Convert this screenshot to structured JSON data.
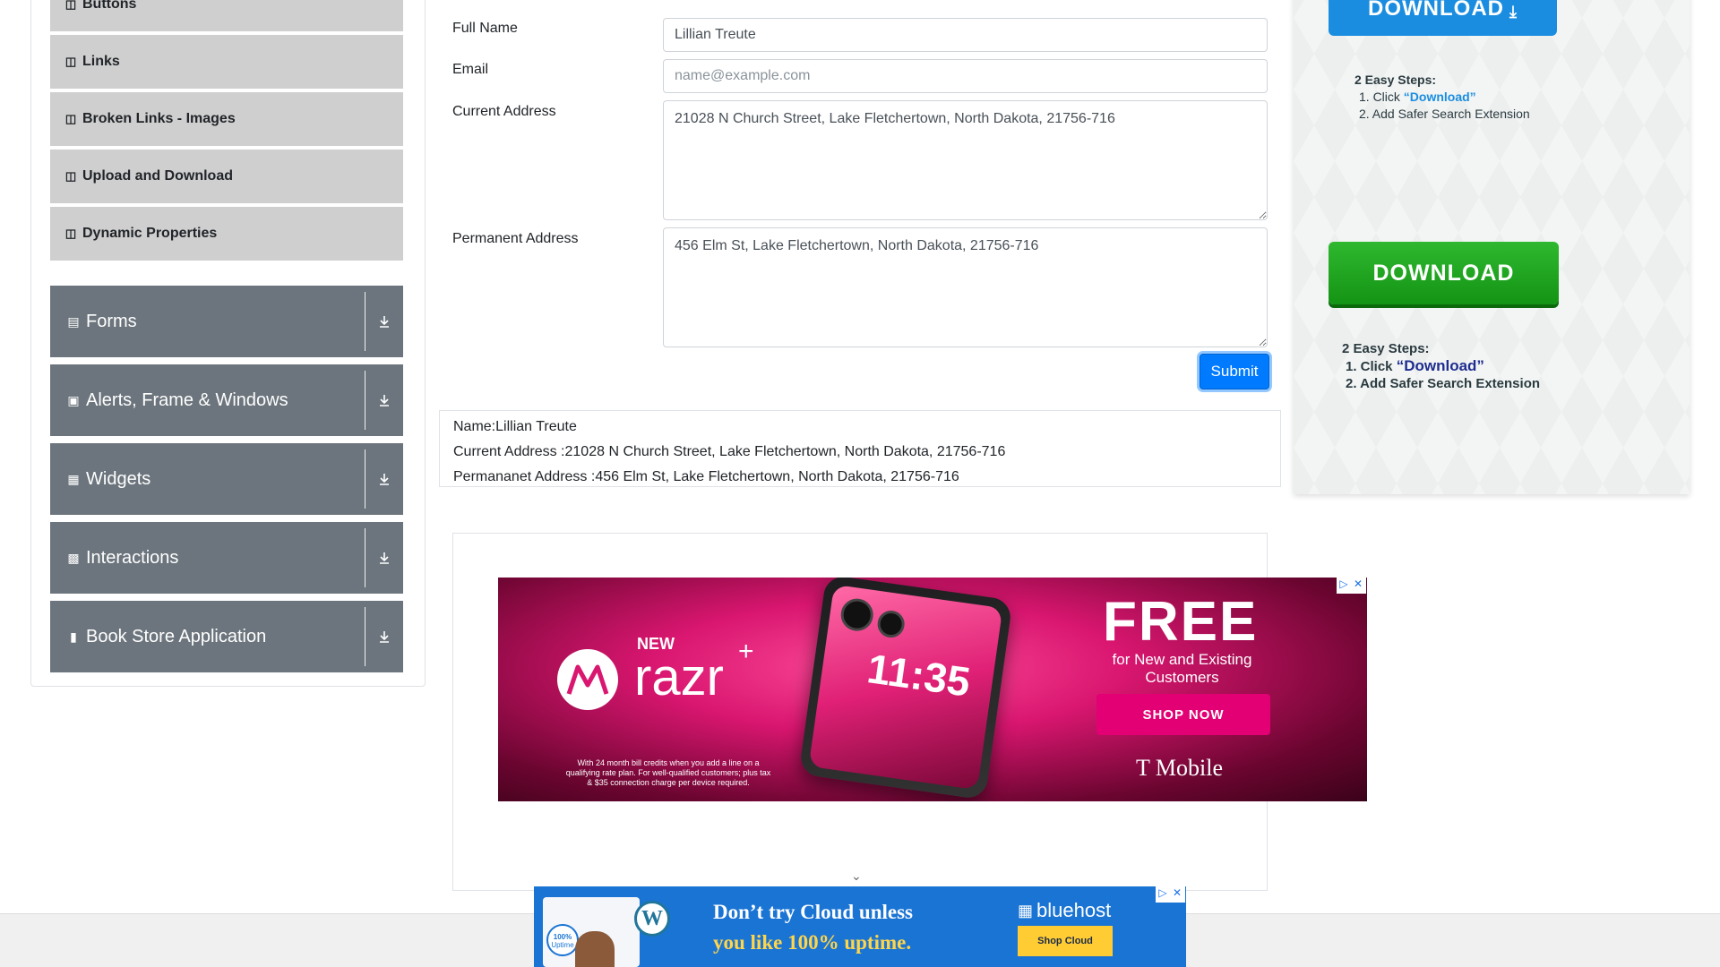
{
  "sidebar": {
    "sub_items": [
      {
        "label": "Buttons"
      },
      {
        "label": "Links"
      },
      {
        "label": "Broken Links - Images"
      },
      {
        "label": "Upload and Download"
      },
      {
        "label": "Dynamic Properties"
      }
    ],
    "groups": [
      {
        "label": "Forms",
        "icon": "form-icon"
      },
      {
        "label": "Alerts, Frame & Windows",
        "icon": "window-icon"
      },
      {
        "label": "Widgets",
        "icon": "widgets-icon"
      },
      {
        "label": "Interactions",
        "icon": "interactions-icon"
      },
      {
        "label": "Book Store Application",
        "icon": "books-icon"
      }
    ]
  },
  "form": {
    "full_name": {
      "label": "Full Name",
      "value": "Lillian Treute"
    },
    "email": {
      "label": "Email",
      "placeholder": "name@example.com",
      "value": ""
    },
    "current_address": {
      "label": "Current Address",
      "value": "21028 N Church Street, Lake Fletchertown, North Dakota, 21756-716"
    },
    "permanent_address": {
      "label": "Permanent Address",
      "value": "456 Elm St, Lake Fletchertown, North Dakota, 21756-716"
    },
    "submit_label": "Submit"
  },
  "output": {
    "name": "Name:Lillian Treute",
    "current_address": "Current Address :21028 N Church Street, Lake Fletchertown, North Dakota, 21756-716",
    "permanent_address": "Permananet Address :456 Elm St, Lake Fletchertown, North Dakota, 21756-716"
  },
  "right_ad": {
    "download_top": "DOWNLOAD",
    "steps_title": "2 Easy Steps:",
    "step1_prefix": "1. Click ",
    "step1_link": "“Download”",
    "step2": "2. Add Safer Search Extension",
    "download_main": "DOWNLOAD"
  },
  "moto_ad": {
    "new": "NEW",
    "product": "razr",
    "plus": "+",
    "time": "11:35",
    "headline": "FREE",
    "subline1": "for New and Existing",
    "subline2": "Customers",
    "cta": "SHOP NOW",
    "brand": "T Mobile",
    "fine_print1": "With 24 month bill credits when you add a line on a",
    "fine_print2": "qualifying rate plan. For well-qualified customers; plus tax",
    "fine_print3": "& $35 connection charge per device required."
  },
  "bottom_ad": {
    "line1": "Don’t try Cloud unless",
    "line2": "you like 100% uptime.",
    "brand": "bluehost",
    "cta": "Shop Cloud",
    "badge": "100%",
    "badge_sub": "Uptime"
  },
  "colors": {
    "primary": "#007bff",
    "sidebar_group": "#6c757d",
    "sidebar_sub": "#cfcfcf",
    "download_green": "#1fa51f",
    "download_blue": "#1a8de0"
  }
}
